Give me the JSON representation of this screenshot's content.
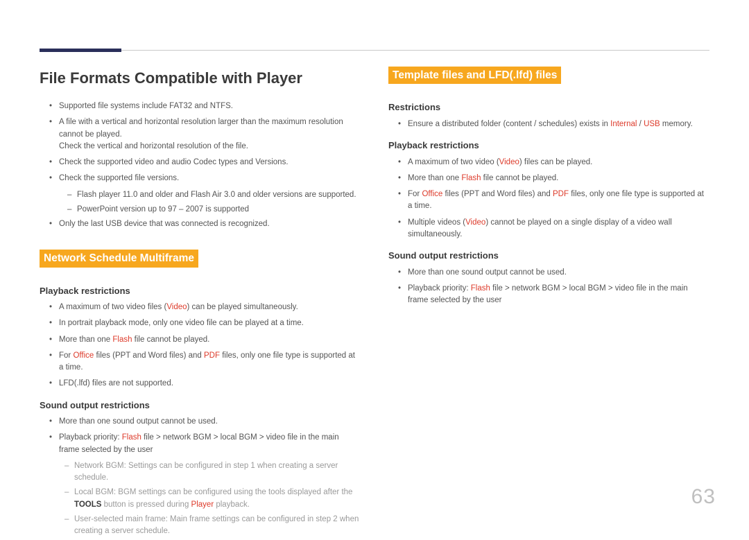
{
  "pageNum": "63",
  "title": "File Formats Compatible with Player",
  "intro": [
    {
      "t": "plain",
      "text": "Supported file systems include FAT32 and NTFS."
    },
    {
      "t": "multi",
      "text": "A file with a vertical and horizontal resolution larger than the maximum resolution cannot be played.",
      "sub": "Check the vertical and horizontal resolution of the file."
    },
    {
      "t": "plain",
      "text": "Check the supported video and audio Codec types and Versions."
    },
    {
      "t": "plain",
      "text": "Check the supported file versions."
    },
    {
      "t": "dash",
      "items": [
        "Flash player 11.0 and older and Flash Air 3.0 and older versions are supported.",
        "PowerPoint version up to 97 – 2007 is supported"
      ]
    },
    {
      "t": "plain",
      "text": "Only the last USB device that was connected is recognized."
    }
  ],
  "nsm": {
    "heading": "Network Schedule Multiframe",
    "pb": {
      "heading": "Playback restrictions",
      "items": [
        {
          "pre": "A maximum of two video files (",
          "r": "Video",
          "post": ") can be played simultaneously."
        },
        {
          "pre": "In portrait playback mode, only one video file can be played at a time.",
          "r": "",
          "post": ""
        },
        {
          "pre": "More than one ",
          "r": "Flash",
          "post": " file cannot be played."
        },
        {
          "pre": "For ",
          "r": "Office",
          "mid": " files (PPT and Word files) and ",
          "r2": "PDF",
          "post": " files, only one file type is supported at a time."
        },
        {
          "pre": "LFD(.lfd) files are not supported.",
          "r": "",
          "post": ""
        }
      ]
    },
    "so": {
      "heading": "Sound output restrictions",
      "items": [
        "More than one sound output cannot be used.",
        {
          "pre": "Playback priority: ",
          "r": "Flash",
          "post": " file > network BGM > local BGM > video file in the main frame selected by the user"
        }
      ],
      "dash": [
        "Network BGM: Settings can be configured in step 1 when creating a server schedule.",
        {
          "pre": "Local BGM: BGM settings can be configured using the tools displayed after the ",
          "b": "TOOLS",
          "mid": " button is pressed during ",
          "r": "Player",
          "post": " playback."
        },
        "User-selected main frame: Main frame settings can be configured in step 2 when creating a server schedule."
      ]
    }
  },
  "tpl": {
    "heading": "Template files and LFD(.lfd) files",
    "rest": {
      "heading": "Restrictions",
      "item": {
        "pre": "Ensure a distributed folder (content / schedules) exists in ",
        "r": "Internal",
        "mid": " / ",
        "r2": "USB",
        "post": " memory."
      }
    },
    "pb": {
      "heading": "Playback restrictions",
      "items": [
        {
          "pre": "A maximum of two video (",
          "r": "Video",
          "post": ") files can be played."
        },
        {
          "pre": "More than one ",
          "r": "Flash",
          "post": " file cannot be played."
        },
        {
          "pre": "For ",
          "r": "Office",
          "mid": " files (PPT and Word files) and ",
          "r2": "PDF",
          "post": " files, only one file type is supported at a time."
        },
        {
          "pre": "Multiple videos (",
          "r": "Video",
          "post": ") cannot be played on a single display of a video wall simultaneously."
        }
      ]
    },
    "so": {
      "heading": "Sound output restrictions",
      "items": [
        "More than one sound output cannot be used.",
        {
          "pre": "Playback priority: ",
          "r": "Flash",
          "post": " file > network BGM > local BGM > video file in the main frame selected by the user"
        }
      ]
    }
  }
}
